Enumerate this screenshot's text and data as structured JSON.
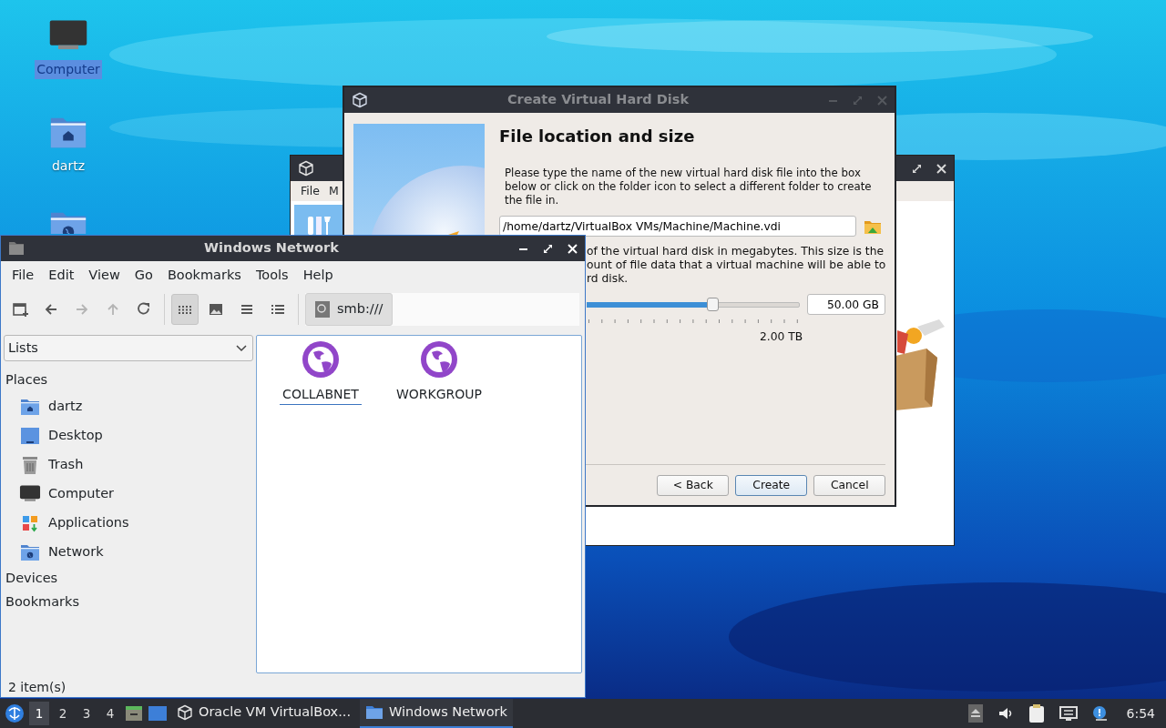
{
  "desktop": {
    "icons": [
      {
        "label": "Computer",
        "kind": "computer",
        "selected": true
      },
      {
        "label": "dartz",
        "kind": "home",
        "selected": false
      },
      {
        "kind": "network",
        "selected": false
      }
    ]
  },
  "virtualbox_window": {
    "menu": [
      "File",
      "M"
    ]
  },
  "dialog": {
    "title": "Create Virtual Hard Disk",
    "heading": "File location and size",
    "intro": "Please type the name of the new virtual hard disk file into the box below or click on the folder icon to select a different folder to create the file in.",
    "path": "/home/dartz/VirtualBox VMs/Machine/Machine.vdi",
    "size_lines": [
      "of the virtual hard disk in megabytes. This size is the",
      "ount of file data that a virtual machine will be able to",
      "rd disk."
    ],
    "size": {
      "level": 0.59,
      "max_label": "2.00 TB",
      "value": "50.00 GB"
    },
    "buttons": [
      {
        "label": "< Back",
        "default": false
      },
      {
        "label": "Create",
        "default": true
      },
      {
        "label": "Cancel",
        "default": false
      }
    ]
  },
  "file_manager": {
    "title": "Windows Network",
    "menu": [
      "File",
      "Edit",
      "View",
      "Go",
      "Bookmarks",
      "Tools",
      "Help"
    ],
    "nav_buttons": [
      {
        "kind": "new-tab",
        "disabled": false
      },
      {
        "kind": "back",
        "disabled": false
      },
      {
        "kind": "forward",
        "disabled": true
      },
      {
        "kind": "up",
        "disabled": true
      },
      {
        "kind": "reload",
        "disabled": false
      }
    ],
    "view_buttons": [
      {
        "kind": "icons",
        "selected": true
      },
      {
        "kind": "thumbnails",
        "selected": false
      },
      {
        "kind": "compact",
        "selected": false
      },
      {
        "kind": "details",
        "selected": false
      }
    ],
    "path": "smb:///",
    "side_pane_mode": "Lists",
    "sections": [
      {
        "label": "Places",
        "items": [
          {
            "label": "dartz",
            "kind": "home"
          },
          {
            "label": "Desktop",
            "kind": "desktop"
          },
          {
            "label": "Trash",
            "kind": "trash"
          },
          {
            "label": "Computer",
            "kind": "computer"
          },
          {
            "label": "Applications",
            "kind": "applications"
          },
          {
            "label": "Network",
            "kind": "network"
          }
        ]
      },
      {
        "label": "Devices"
      },
      {
        "label": "Bookmarks"
      }
    ],
    "files": [
      {
        "label": "COLLABNET",
        "focused": true
      },
      {
        "label": "WORKGROUP",
        "focused": false
      }
    ],
    "status": "2 item(s)"
  },
  "taskbar": {
    "workspaces": [
      {
        "label": "1",
        "selected": true
      },
      {
        "label": "2",
        "selected": false
      },
      {
        "label": "3",
        "selected": false
      },
      {
        "label": "4",
        "selected": false
      }
    ],
    "tasks": [
      {
        "label": "Oracle VM VirtualBox...",
        "kind": "virtualbox",
        "active": false
      },
      {
        "label": "Windows Network",
        "kind": "folder",
        "active": true
      }
    ],
    "clock": "6:54"
  }
}
